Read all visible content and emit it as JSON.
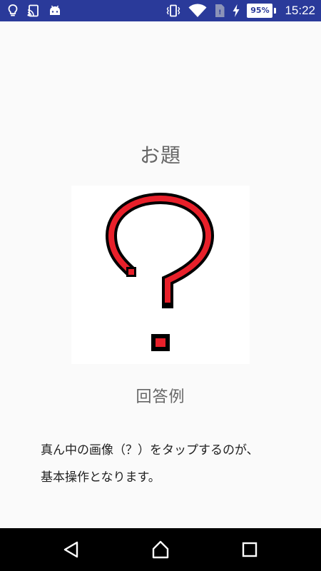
{
  "status_bar": {
    "time": "15:22",
    "battery_percent": "95%",
    "icons_left": [
      "lightbulb-icon",
      "cast-icon",
      "android-icon"
    ],
    "icons_right": [
      "vibrate-icon",
      "wifi-icon",
      "sim-icon",
      "charging-icon",
      "battery-icon"
    ],
    "background_color": "#2a3a9a"
  },
  "main": {
    "title": "お題",
    "image_icon": "question-mark-pixel-icon",
    "answer_label": "回答例",
    "instruction_lines": [
      "真ん中の画像（？）をタップするのが、",
      "基本操作となります。"
    ]
  },
  "colors": {
    "question_mark_fill": "#e8202a",
    "question_mark_outline": "#000000"
  },
  "nav_bar": {
    "buttons": [
      "back-icon",
      "home-icon",
      "recents-icon"
    ]
  }
}
